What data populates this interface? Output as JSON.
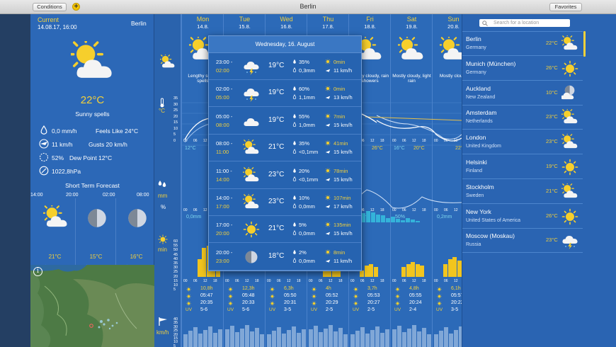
{
  "window": {
    "title": "Berlin",
    "conditions_label": "Conditions",
    "add_label": "+",
    "favorites_label": "Favorites"
  },
  "current": {
    "label": "Current",
    "datetime": "14.08.17, 16:00",
    "city": "Berlin",
    "temp": "22°C",
    "condition": "Sunny spells",
    "precip": "0,0 mm/h",
    "feels_like": "Feels Like  24°C",
    "wind": "11 km/h",
    "gusts": "Gusts  20 km/h",
    "humidity": "52%",
    "dew_point": "Dew Point  12°C",
    "pressure": "1022,8hPa"
  },
  "short_term": {
    "title": "Short Term Forecast",
    "hours": [
      "14:00",
      "20:00",
      "02:00",
      "08:00"
    ],
    "items": [
      {
        "temp": "21°C",
        "precip": "0,0mm",
        "icon": "sun-cloud-icon"
      },
      {
        "temp": "15°C",
        "precip": "0,0mm",
        "icon": "moon-icon"
      },
      {
        "temp": "16°C",
        "precip": "0,0mm",
        "icon": "moon-icon"
      }
    ]
  },
  "axis": {
    "temp_unit": "°C",
    "precip_unit": "mm",
    "percent_unit": "%",
    "sun_unit": "min",
    "wind_unit": "km/h",
    "temp_ticks": [
      "35",
      "30",
      "25",
      "20",
      "15",
      "10",
      "5",
      "0"
    ],
    "sun_ticks": [
      "60",
      "55",
      "50",
      "45",
      "40",
      "35",
      "30",
      "25",
      "20",
      "15",
      "10",
      "5"
    ],
    "wind_ticks": [
      "40",
      "35",
      "30",
      "25",
      "20",
      "15",
      "10",
      "5"
    ]
  },
  "days": [
    {
      "name": "Mon",
      "date": "14.8.",
      "cond": "Lengthy sunny spells",
      "hi": "",
      "lo": "12°C",
      "rain": "0,0mm",
      "sun_hours": "10,8h",
      "sunrise": "05:47",
      "sunset": "20:35",
      "uv": "5-6",
      "bars": [
        0,
        0,
        0,
        0.55,
        0.9,
        0.95,
        0.85,
        0.6
      ]
    },
    {
      "name": "Tue",
      "date": "15.8.",
      "cond": "",
      "hi": "",
      "lo": "",
      "rain": "",
      "sun_hours": "12,3h",
      "sunrise": "05:48",
      "sunset": "20:33",
      "uv": "5-6",
      "bars": [
        0,
        0,
        0,
        0,
        0,
        0,
        0,
        0
      ]
    },
    {
      "name": "Wed",
      "date": "16.8.",
      "cond": "",
      "hi": "",
      "lo": "",
      "rain": "",
      "sun_hours": "6,3h",
      "sunrise": "05:50",
      "sunset": "20:31",
      "uv": "3-5",
      "bars": [
        0,
        0,
        0,
        0,
        0,
        0,
        0,
        0
      ]
    },
    {
      "name": "Thu",
      "date": "17.8.",
      "cond": "",
      "hi": "",
      "lo": "",
      "rain": "",
      "sun_hours": "4h",
      "sunrise": "05:52",
      "sunset": "20:29",
      "uv": "2-5",
      "bars": [
        0,
        0,
        0,
        0.25,
        0.3,
        0.35,
        0.3,
        0
      ]
    },
    {
      "name": "Fri",
      "date": "18.8.",
      "cond": "Mostly cloudy, rain showers",
      "hi": "26°C",
      "lo": "",
      "rain": "4,1mm",
      "sun_hours": "3,7h",
      "sunrise": "05:53",
      "sunset": "20:27",
      "uv": "2-5",
      "bars": [
        0,
        0,
        0.2,
        0.35,
        0.4,
        0.3,
        0,
        0
      ]
    },
    {
      "name": "Sat",
      "date": "19.8.",
      "cond": "Mostly cloudy, light rain",
      "hi": "20°C",
      "lo": "16°C",
      "rain": "50%",
      "sun_hours": "4,8h",
      "sunrise": "05:55",
      "sunset": "20:24",
      "uv": "2-4",
      "bars": [
        0,
        0,
        0.3,
        0.4,
        0.45,
        0.4,
        0.35,
        0
      ]
    },
    {
      "name": "Sun",
      "date": "20.8.",
      "cond": "Mostly cloudy",
      "hi": "22°C",
      "lo": "",
      "rain": "0,2mm",
      "sun_hours": "6,1h",
      "sunrise": "05:57",
      "sunset": "20:22",
      "uv": "3-5",
      "bars": [
        0,
        0,
        0.4,
        0.55,
        0.6,
        0.5,
        0,
        0
      ]
    }
  ],
  "time_ticks": [
    "00",
    "06",
    "12",
    "18"
  ],
  "popup": {
    "title": "Wednesday, 16. August",
    "rows": [
      {
        "t1": "23:00 -",
        "t2": "02:00",
        "icon": "thunder-cloud-icon",
        "temp": "19°C",
        "prob": "35%",
        "amount": "0,3mm",
        "sun": "0min",
        "wind": "11 km/h"
      },
      {
        "t1": "02:00 -",
        "t2": "05:00",
        "icon": "thunder-cloud-icon",
        "temp": "19°C",
        "prob": "60%",
        "amount": "1,1mm",
        "sun": "0min",
        "wind": "13 km/h"
      },
      {
        "t1": "05:00 -",
        "t2": "08:00",
        "icon": "cloud-icon",
        "temp": "19°C",
        "prob": "55%",
        "amount": "1,0mm",
        "sun": "7min",
        "wind": "15 km/h"
      },
      {
        "t1": "08:00 -",
        "t2": "11:00",
        "icon": "sun-cloud-icon",
        "temp": "21°C",
        "prob": "35%",
        "amount": "<0,1mm",
        "sun": "41min",
        "wind": "15 km/h"
      },
      {
        "t1": "11:00 -",
        "t2": "14:00",
        "icon": "sun-cloud-icon",
        "temp": "23°C",
        "prob": "20%",
        "amount": "<0,1mm",
        "sun": "78min",
        "wind": "15 km/h"
      },
      {
        "t1": "14:00 -",
        "t2": "17:00",
        "icon": "sun-cloud-icon",
        "temp": "23°C",
        "prob": "10%",
        "amount": "0,0mm",
        "sun": "107min",
        "wind": "17 km/h"
      },
      {
        "t1": "17:00 -",
        "t2": "20:00",
        "icon": "sun-icon",
        "temp": "21°C",
        "prob": "5%",
        "amount": "0,0mm",
        "sun": "135min",
        "wind": "15 km/h"
      },
      {
        "t1": "20:00 -",
        "t2": "23:00",
        "icon": "moon-icon",
        "temp": "18°C",
        "prob": "2%",
        "amount": "0,0mm",
        "sun": "8min",
        "wind": "11 km/h"
      }
    ]
  },
  "favorites": {
    "search_placeholder": "Search for a location",
    "cities": [
      {
        "name": "Berlin",
        "country": "Germany",
        "temp": "22°C",
        "icon": "sun-cloud-icon"
      },
      {
        "name": "Munich (München)",
        "country": "Germany",
        "temp": "26°C",
        "icon": "sun-icon"
      },
      {
        "name": "Auckland",
        "country": "New Zealand",
        "temp": "10°C",
        "icon": "moon-cloud-icon"
      },
      {
        "name": "Amsterdam",
        "country": "Netherlands",
        "temp": "23°C",
        "icon": "sun-cloud-icon"
      },
      {
        "name": "London",
        "country": "United Kingdom",
        "temp": "23°C",
        "icon": "sun-cloud-icon"
      },
      {
        "name": "Helsinki",
        "country": "Finland",
        "temp": "19°C",
        "icon": "sun-icon"
      },
      {
        "name": "Stockholm",
        "country": "Sweden",
        "temp": "21°C",
        "icon": "sun-cloud-icon"
      },
      {
        "name": "New York",
        "country": "United States of America",
        "temp": "26°C",
        "icon": "sun-icon"
      },
      {
        "name": "Moscow (Moskau)",
        "country": "Russia",
        "temp": "23°C",
        "icon": "thunder-cloud-icon"
      }
    ]
  },
  "colors": {
    "accent": "#f4d13a",
    "panel": "#2c68b7",
    "rain": "#34b3da"
  }
}
